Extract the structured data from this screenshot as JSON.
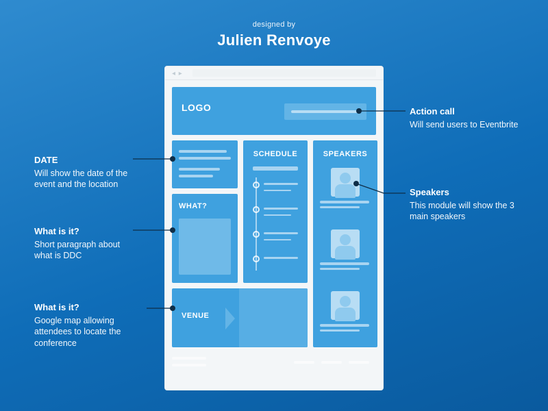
{
  "credit": {
    "by": "designed by",
    "name": "Julien Renvoye"
  },
  "wire": {
    "logo": "LOGO",
    "what": "WHAT?",
    "schedule": "SCHEDULE",
    "speakers": "SPEAKERS",
    "venue": "VENUE"
  },
  "annos": {
    "cta": {
      "title": "Action call",
      "body": "Will send users to Eventbrite"
    },
    "date": {
      "title": "DATE",
      "body": "Will show the date of the event and the location"
    },
    "what": {
      "title": "What is it?",
      "body": "Short paragraph about what is DDC"
    },
    "venue": {
      "title": "What is it?",
      "body": "Google map allowing attendees to locate the conference"
    },
    "speakers": {
      "title": "Speakers",
      "body": "This module will show the 3 main speakers"
    }
  }
}
